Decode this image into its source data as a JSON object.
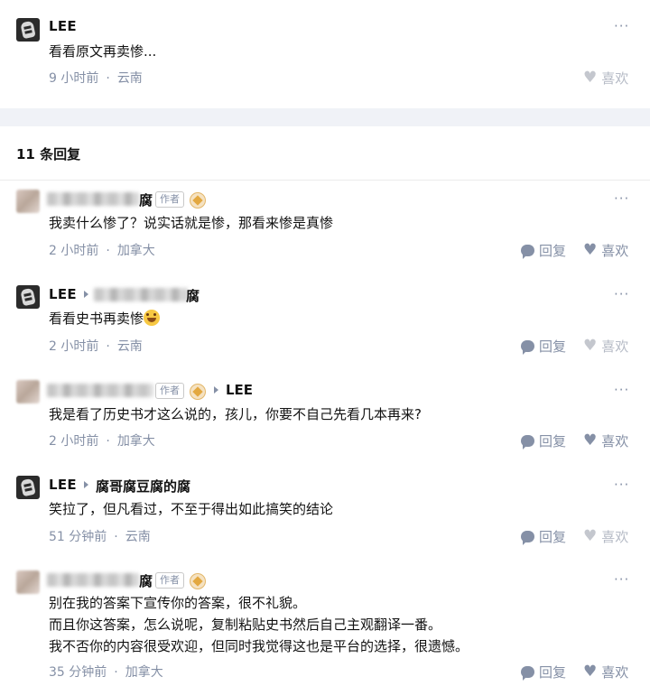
{
  "top_comment": {
    "author": "LEE",
    "text": "看看原文再卖惨...",
    "time": "9 小时前",
    "location": "云南",
    "like_label": "喜欢",
    "more": "···"
  },
  "replies_header": "11 条回复",
  "labels": {
    "author_tag": "作者",
    "reply": "回复",
    "like": "喜欢",
    "more": "···",
    "sep": "·"
  },
  "replies": [
    {
      "author_tail": "腐",
      "author_tag": true,
      "text": "我卖什么惨了？说实话就是惨，那看来惨是真惨",
      "time": "2 小时前",
      "location": "加拿大"
    },
    {
      "author": "LEE",
      "reply_to_tail": "腐",
      "text": "看看史书再卖惨",
      "emoji": "rofl-emoji",
      "time": "2 小时前",
      "location": "云南"
    },
    {
      "author_tag": true,
      "reply_to": "LEE",
      "text": "我是看了历史书才这么说的，孩儿，你要不自己先看几本再来?",
      "time": "2 小时前",
      "location": "加拿大"
    },
    {
      "author": "LEE",
      "reply_to": "腐哥腐豆腐的腐",
      "text": "笑拉了，但凡看过，不至于得出如此搞笑的结论",
      "time": "51 分钟前",
      "location": "云南"
    },
    {
      "author_tail": "腐",
      "author_tag": true,
      "lines": [
        "别在我的答案下宣传你的答案，很不礼貌。",
        "而且你这答案，怎么说呢，复制粘贴史书然后自己主观翻译一番。",
        "我不否你的内容很受欢迎，但同时我觉得这也是平台的选择，很遗憾。"
      ],
      "time": "35 分钟前",
      "location": "加拿大"
    }
  ],
  "colors": {
    "text": "#121212",
    "meta": "#8590a6",
    "band": "#f0f2f7",
    "badge": "#e3a840"
  },
  "icons": [
    "user-avatar",
    "blurred-avatar",
    "author-badge-icon",
    "reply-arrow-icon",
    "comment-bubble-icon",
    "heart-icon",
    "more-icon"
  ]
}
